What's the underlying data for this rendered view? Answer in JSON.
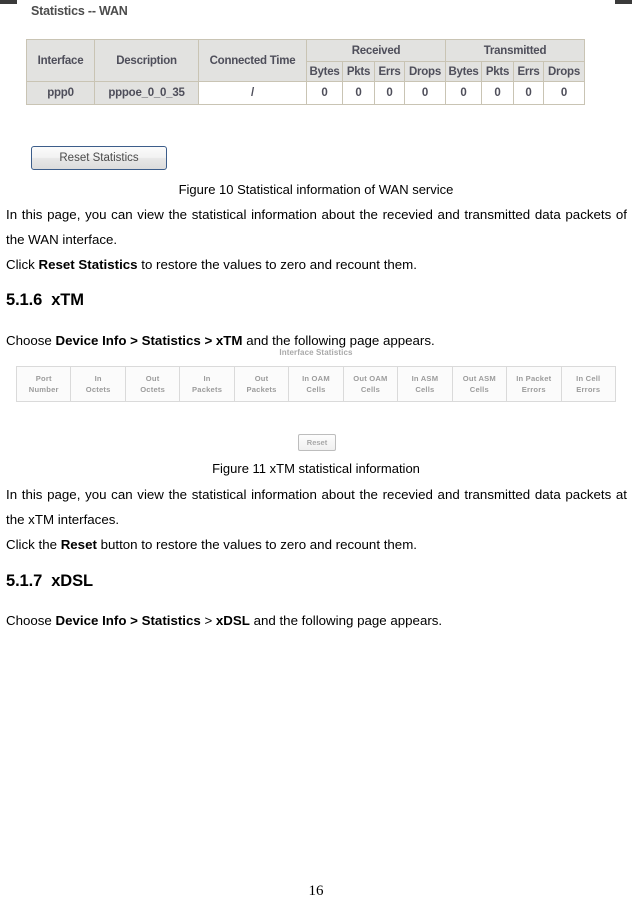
{
  "page": {
    "number": "16"
  },
  "wan_screenshot": {
    "title": "Statistics -- WAN",
    "table": {
      "group_headers": [
        "Interface",
        "Description",
        "Connected Time",
        "Received",
        "Transmitted"
      ],
      "sub_headers": [
        "Bytes",
        "Pkts",
        "Errs",
        "Drops",
        "Bytes",
        "Pkts",
        "Errs",
        "Drops"
      ],
      "rows": [
        {
          "interface": "ppp0",
          "description": "pppoe_0_0_35",
          "connected_time": "/",
          "received": {
            "bytes": "0",
            "pkts": "0",
            "errs": "0",
            "drops": "0"
          },
          "transmitted": {
            "bytes": "0",
            "pkts": "0",
            "errs": "0",
            "drops": "0"
          }
        }
      ]
    },
    "reset_button_label": "Reset Statistics"
  },
  "figure10": {
    "caption": "Figure 10 Statistical information of WAN service"
  },
  "wan_body": {
    "paragraph1": "In this page, you can view the statistical information about the recevied and transmitted data packets of the WAN interface.",
    "line2_prefix": "Click ",
    "line2_bold": "Reset Statistics",
    "line2_suffix": " to restore the values to zero and recount them."
  },
  "section_xtm": {
    "number": "5.1.6",
    "title": "xTM",
    "choose_prefix": "Choose ",
    "choose_bold": "Device Info > Statistics > xTM",
    "choose_suffix": " and the following page appears."
  },
  "xtm_screenshot": {
    "caption": "Interface Statistics",
    "columns": [
      {
        "line1": "Port",
        "line2": "Number"
      },
      {
        "line1": "In",
        "line2": "Octets"
      },
      {
        "line1": "Out",
        "line2": "Octets"
      },
      {
        "line1": "In",
        "line2": "Packets"
      },
      {
        "line1": "Out",
        "line2": "Packets"
      },
      {
        "line1": "In OAM",
        "line2": "Cells"
      },
      {
        "line1": "Out OAM",
        "line2": "Cells"
      },
      {
        "line1": "In ASM",
        "line2": "Cells"
      },
      {
        "line1": "Out ASM",
        "line2": "Cells"
      },
      {
        "line1": "In Packet",
        "line2": "Errors"
      },
      {
        "line1": "In Cell",
        "line2": "Errors"
      }
    ],
    "reset_button_label": "Reset"
  },
  "figure11": {
    "caption": "Figure 11 xTM statistical information"
  },
  "xtm_body": {
    "paragraph1": "In this page, you can view the statistical information about the recevied and transmitted data packets at the xTM interfaces.",
    "line2_prefix": "Click the ",
    "line2_bold": "Reset",
    "line2_suffix": " button to restore the values to zero and recount them."
  },
  "section_xdsl": {
    "number": "5.1.7",
    "title": "xDSL",
    "choose_prefix": "Choose ",
    "choose_bold1": "Device Info > Statistics",
    "choose_mid": " > ",
    "choose_bold2": "xDSL",
    "choose_suffix": " and the following page appears."
  }
}
